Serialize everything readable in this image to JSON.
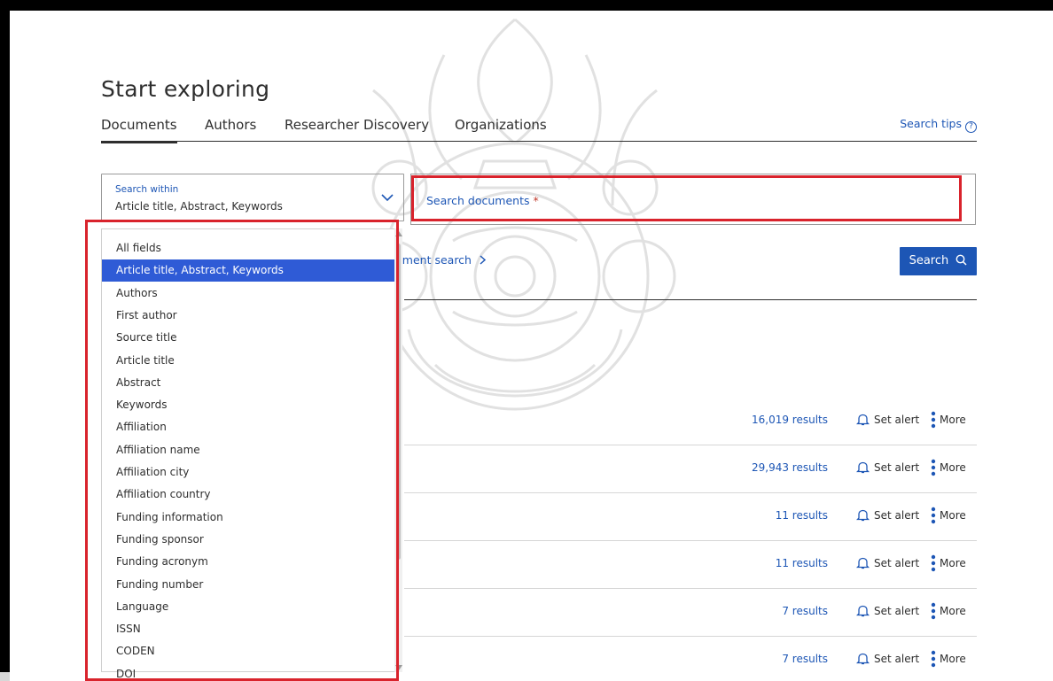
{
  "page": {
    "title": "Start exploring"
  },
  "tabs": [
    {
      "label": "Documents",
      "active": true
    },
    {
      "label": "Authors",
      "active": false
    },
    {
      "label": "Researcher Discovery",
      "active": false
    },
    {
      "label": "Organizations",
      "active": false
    }
  ],
  "search_tips": {
    "label": "Search tips",
    "icon": "question-circle-icon"
  },
  "search_within": {
    "label": "Search within",
    "value": "Article title, Abstract, Keywords",
    "icon": "chevron-down-icon"
  },
  "search_documents": {
    "placeholder": "Search documents",
    "required_mark": "*"
  },
  "advanced_search": {
    "label": "cument search",
    "icon": "chevron-right-icon"
  },
  "search_button": {
    "label": "Search",
    "icon": "search-icon"
  },
  "dropdown": {
    "selected_index": 1,
    "options": [
      "All fields",
      "Article title, Abstract, Keywords",
      "Authors",
      "First author",
      "Source title",
      "Article title",
      "Abstract",
      "Keywords",
      "Affiliation",
      "Affiliation name",
      "Affiliation city",
      "Affiliation country",
      "Funding information",
      "Funding sponsor",
      "Funding acronym",
      "Funding number",
      "Language",
      "ISSN",
      "CODEN",
      "DOI"
    ]
  },
  "results": [
    {
      "count": "16,019 results",
      "alert": "Set alert",
      "more": "More"
    },
    {
      "count": "29,943 results",
      "alert": "Set alert",
      "more": "More"
    },
    {
      "count": "11 results",
      "alert": "Set alert",
      "more": "More"
    },
    {
      "count": "11 results",
      "alert": "Set alert",
      "more": "More"
    },
    {
      "count": "7 results",
      "alert": "Set alert",
      "more": "More"
    },
    {
      "count": "7 results",
      "alert": "Set alert",
      "more": "More"
    }
  ],
  "colors": {
    "accent": "#1d56b5",
    "selected": "#2f5bd6",
    "highlight_box": "#d9232c"
  }
}
